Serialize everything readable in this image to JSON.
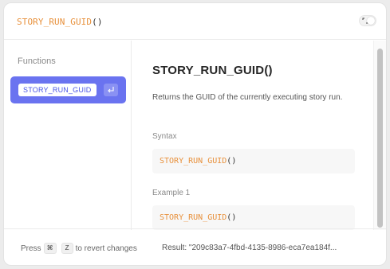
{
  "header": {
    "formula_name": "STORY_RUN_GUID",
    "formula_parens": "()"
  },
  "sidebar": {
    "heading": "Functions",
    "selected_function": "STORY_RUN_GUID"
  },
  "doc": {
    "title": "STORY_RUN_GUID()",
    "description": "Returns the GUID of the currently executing story run.",
    "syntax_label": "Syntax",
    "syntax_name": "STORY_RUN_GUID",
    "syntax_parens": "()",
    "example_label": "Example 1",
    "example_name": "STORY_RUN_GUID",
    "example_parens": "()"
  },
  "footer": {
    "press": "Press",
    "key_cmd": "⌘",
    "key_z": "Z",
    "revert_text": "to revert changes",
    "result": "Result: \"209c83a7-4fbd-4135-8986-eca7ea184f..."
  },
  "colors": {
    "accent": "#6a73f0",
    "function_orange": "#e8913c"
  },
  "icons": {
    "expand": "expand-icon",
    "enter": "enter-key-icon"
  }
}
